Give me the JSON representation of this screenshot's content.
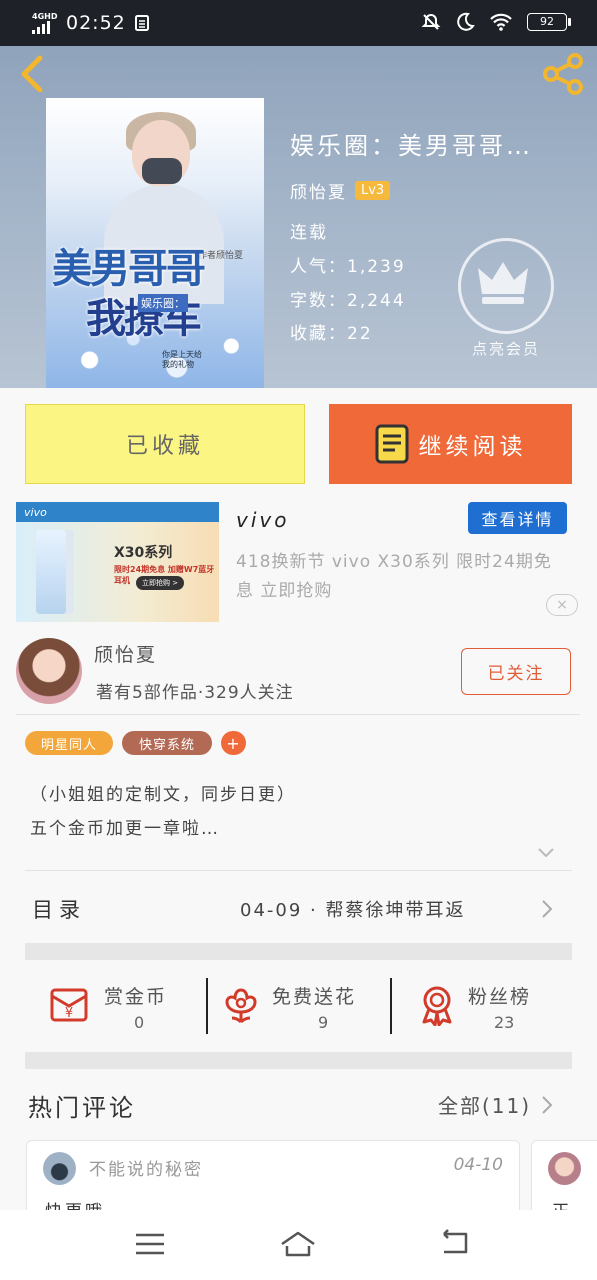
{
  "status_bar": {
    "network": "4GHD",
    "time": "02:52",
    "battery": "92"
  },
  "book": {
    "title": "娱乐圈：美男哥哥…",
    "author": "颀怡夏",
    "level": "Lv3",
    "status": "连载",
    "popularity": "人气：1,239",
    "word_count": "字数：2,244",
    "favorites": "收藏：22",
    "vip_label": "点亮会员",
    "cover": {
      "title_line1": "美男哥哥",
      "title_line2": "我撩车",
      "subtitle": "娱乐圈：",
      "author_credit": "作者颀怡夏",
      "blurb": "你是上天给\n我的礼物"
    }
  },
  "actions": {
    "collected_label": "已收藏",
    "continue_label": "继续阅读"
  },
  "ad": {
    "brand": "vivo",
    "detail_label": "查看详情",
    "description": "418换新节 vivo X30系列 限时24期免息 立即抢购",
    "close_label": "×",
    "image": {
      "banner_brand": "vivo",
      "title": "X30系列",
      "line": "限时24期免息 加赠W7蓝牙耳机",
      "cta": "立即抢购 >"
    }
  },
  "writer": {
    "name": "颀怡夏",
    "stats": "著有5部作品·329人关注",
    "follow_label": "已关注"
  },
  "tags": [
    {
      "label": "明星同人",
      "color": "#f3a73b"
    },
    {
      "label": "快穿系统",
      "color": "#b26a55"
    },
    {
      "label": "+",
      "color": "#ef6939"
    }
  ],
  "intro": {
    "line1": "（小姐姐的定制文，同步日更）",
    "line2": "五个金币加更一章啦…"
  },
  "toc": {
    "label": "目录",
    "latest": "04-09 · 帮蔡徐坤带耳返"
  },
  "stats": [
    {
      "label": "赏金币",
      "value": "0",
      "icon": "red-envelope-icon"
    },
    {
      "label": "免费送花",
      "value": "9",
      "icon": "flower-icon"
    },
    {
      "label": "粉丝榜",
      "value": "23",
      "icon": "medal-icon"
    }
  ],
  "comments": {
    "title": "热门评论",
    "all_label": "全部(11)",
    "items": [
      {
        "user": "不能说的秘密",
        "date": "04-10",
        "text": "快更哦~"
      },
      {
        "user": "",
        "date": "",
        "text": "正"
      }
    ]
  },
  "colors": {
    "accent_orange": "#ef6939",
    "collect_yellow": "#fbf584",
    "level_badge": "#f6b93b",
    "detail_blue": "#1e6fd1"
  }
}
